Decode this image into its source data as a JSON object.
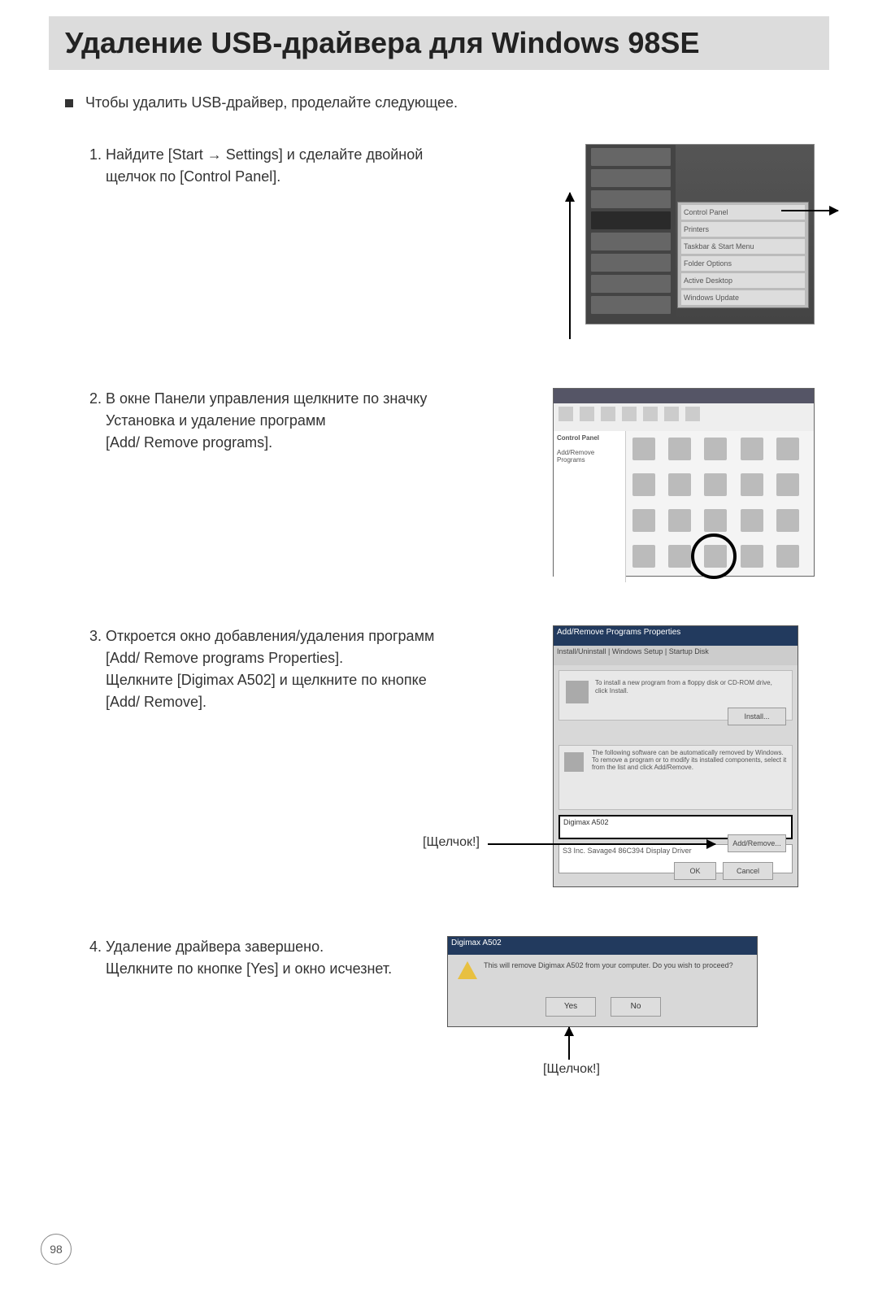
{
  "title": "Удаление USB-драйвера для Windows 98SE",
  "intro": "Чтобы удалить USB-драйвер, проделайте следующее.",
  "steps": {
    "s1": {
      "num": "1.",
      "line1": "Найдите [Start → Settings] и сделайте двойной",
      "line2": "щелчок по [Control Panel]."
    },
    "s2": {
      "num": "2.",
      "line1": "В окне Панели управления щелкните по значку",
      "line2": "Установка и удаление программ",
      "line3": "[Add/ Remove programs]."
    },
    "s3": {
      "num": "3.",
      "line1": "Откроется окно добавления/удаления программ",
      "line2": "[Add/ Remove programs Properties].",
      "line3": "Щелкните [Digimax A502] и щелкните по кнопке",
      "line4": "[Add/ Remove]."
    },
    "s4": {
      "num": "4.",
      "line1": "Удаление драйвера завершено.",
      "line2": "Щелкните по кнопке [Yes] и окно исчезнет."
    }
  },
  "labels": {
    "click": "[Щелчок!]"
  },
  "fig1": {
    "submenu": [
      "Control Panel",
      "Printers",
      "Taskbar & Start Menu",
      "Folder Options",
      "Active Desktop",
      "Windows Update"
    ]
  },
  "fig2": {
    "side_title": "Control Panel",
    "side_text": "Add/Remove Programs"
  },
  "fig3": {
    "title": "Add/Remove Programs Properties",
    "tabs": "Install/Uninstall | Windows Setup | Startup Disk",
    "upper_text": "To install a new program from a floppy disk or CD-ROM drive, click Install.",
    "install": "Install...",
    "mid_text": "The following software can be automatically removed by Windows. To remove a program or to modify its installed components, select it from the list and click Add/Remove.",
    "list_sel": "Digimax A502",
    "list_other": "S3 Inc. Savage4 86C394 Display Driver",
    "addremove": "Add/Remove...",
    "ok": "OK",
    "cancel": "Cancel"
  },
  "fig4": {
    "title": "Digimax A502",
    "msg": "This will remove Digimax A502 from your computer. Do you wish to proceed?",
    "yes": "Yes",
    "no": "No"
  },
  "page_number": "98"
}
